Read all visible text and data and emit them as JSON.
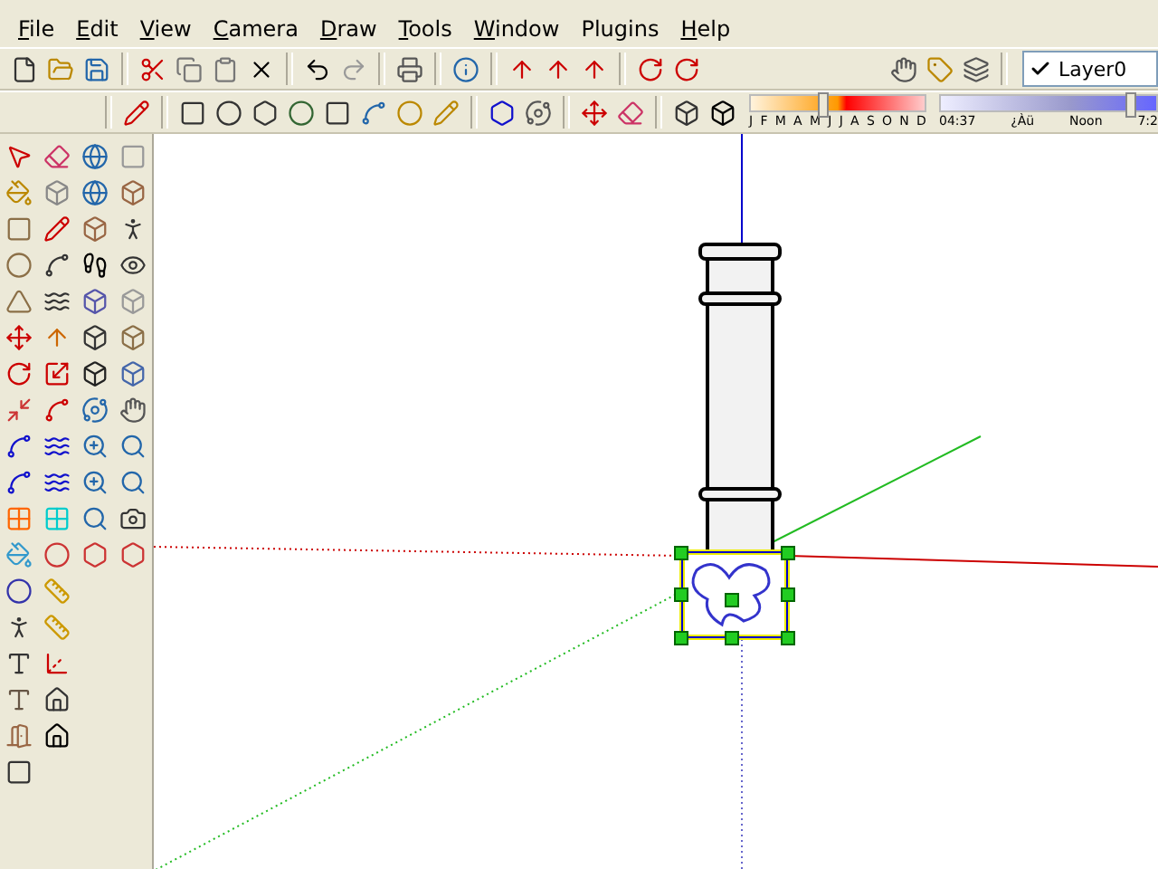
{
  "menu": [
    {
      "label": "File",
      "underlined": true
    },
    {
      "label": "Edit",
      "underlined": true
    },
    {
      "label": "View",
      "underlined": true
    },
    {
      "label": "Camera",
      "underlined": true
    },
    {
      "label": "Draw",
      "underlined": true
    },
    {
      "label": "Tools",
      "underlined": true
    },
    {
      "label": "Window",
      "underlined": true
    },
    {
      "label": "Plugins",
      "underlined": false
    },
    {
      "label": "Help",
      "underlined": true
    }
  ],
  "layers": {
    "value": "Layer0"
  },
  "shadows": {
    "months": [
      "J",
      "F",
      "M",
      "A",
      "M",
      "J",
      "J",
      "A",
      "S",
      "O",
      "N",
      "D"
    ],
    "month_slider": {
      "level": 0.42
    },
    "time_labels": [
      "04:37",
      "¿Àü",
      "Noon",
      "7:2"
    ],
    "time_slider": {
      "level": 0.88
    }
  }
}
